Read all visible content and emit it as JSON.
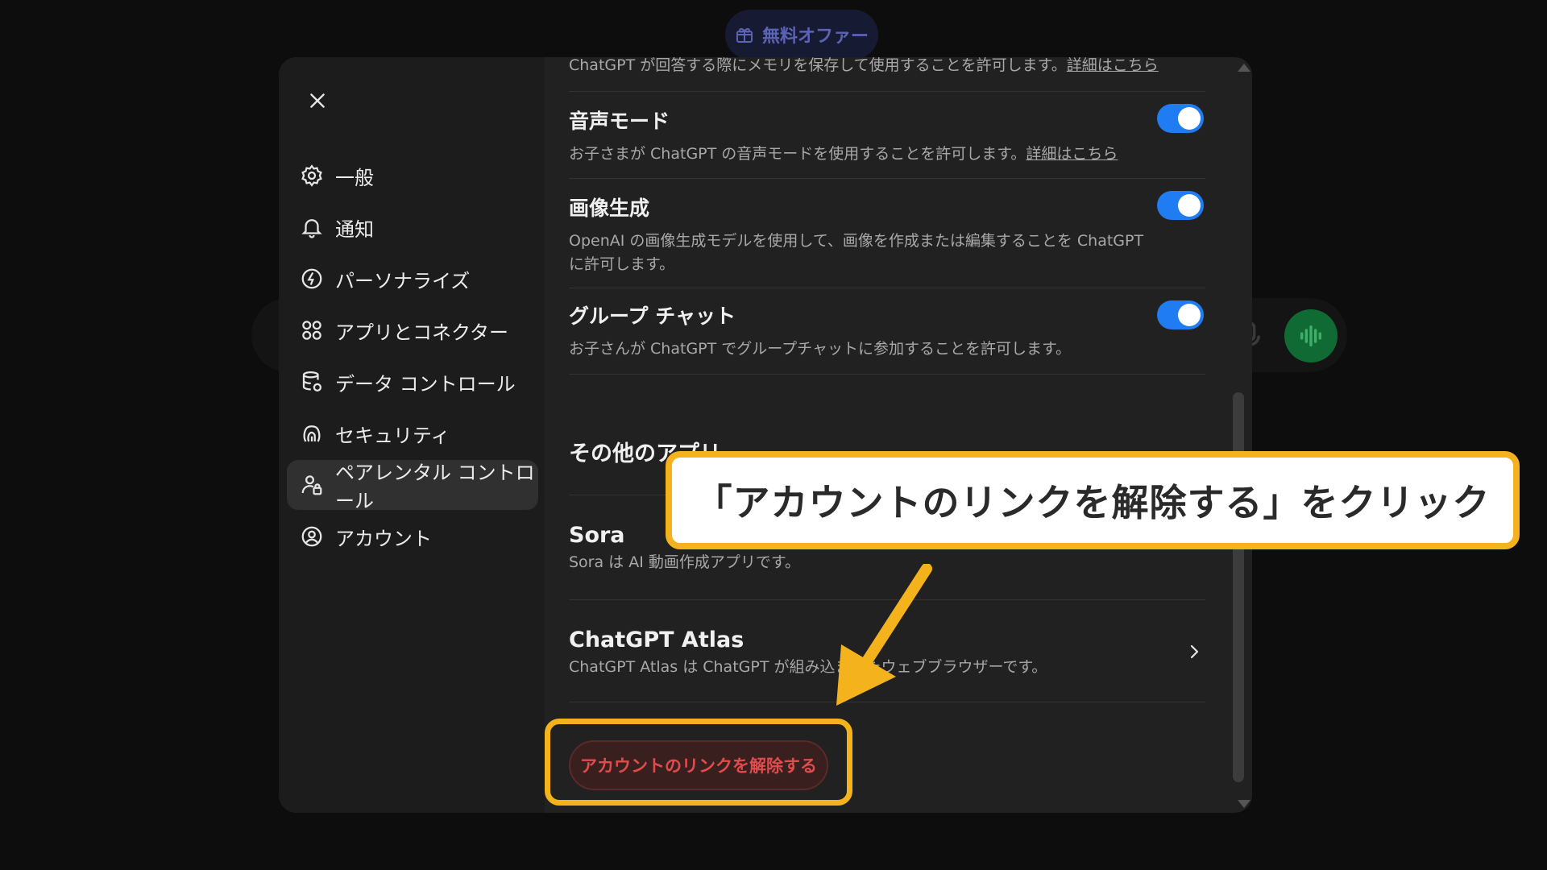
{
  "background": {
    "offer_label": "無料オファー"
  },
  "sidebar": {
    "items": [
      {
        "label": "一般",
        "icon": "gear-icon"
      },
      {
        "label": "通知",
        "icon": "bell-icon"
      },
      {
        "label": "パーソナライズ",
        "icon": "personalize-icon"
      },
      {
        "label": "アプリとコネクター",
        "icon": "apps-icon"
      },
      {
        "label": "データ コントロール",
        "icon": "database-icon"
      },
      {
        "label": "セキュリティ",
        "icon": "security-icon"
      },
      {
        "label": "ペアレンタル コントロール",
        "icon": "parent-icon",
        "active": true
      },
      {
        "label": "アカウント",
        "icon": "account-icon"
      }
    ]
  },
  "content": {
    "memory_desc": "ChatGPT が回答する際にメモリを保存して使用することを許可します。",
    "memory_link": "詳細はこちら",
    "voice": {
      "title": "音声モード",
      "desc": "お子さまが ChatGPT の音声モードを使用することを許可します。",
      "link": "詳細はこちら",
      "enabled": true
    },
    "image_gen": {
      "title": "画像生成",
      "desc_line1": "OpenAI の画像生成モデルを使用して、画像を作成または編集することを ChatGPT",
      "desc_line2": "に許可します。",
      "enabled": true
    },
    "group_chat": {
      "title": "グループ チャット",
      "desc": "お子さんが ChatGPT でグループチャットに参加することを許可します。",
      "enabled": true
    },
    "other_apps_title": "その他のアプリ",
    "sora": {
      "title": "Sora",
      "desc": "Sora は AI 動画作成アプリです。"
    },
    "atlas": {
      "title": "ChatGPT Atlas",
      "desc": "ChatGPT Atlas は ChatGPT が組み込まれたウェブブラウザーです。"
    },
    "unlink_button": "アカウントのリンクを解除する"
  },
  "annotation": {
    "callout_text": "「アカウントのリンクを解除する」をクリック",
    "color": "#f4b21c"
  },
  "colors": {
    "toggle_on": "#1f7cf2",
    "danger": "#e04c4c",
    "voice_button": "#0f6b33"
  }
}
